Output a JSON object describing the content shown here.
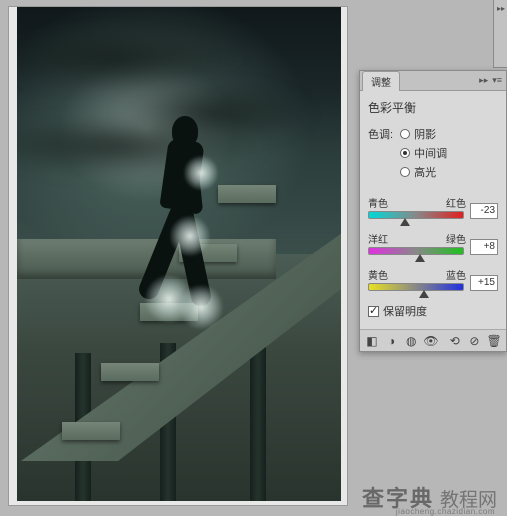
{
  "panel": {
    "tab_label": "调整",
    "title": "色彩平衡",
    "tone_label": "色调:",
    "tones": {
      "shadows": "阴影",
      "midtones": "中间调",
      "highlights": "高光"
    },
    "selected_tone": "midtones",
    "sliders": {
      "cyan_red": {
        "left": "青色",
        "right": "红色",
        "value": "-23",
        "pos_pct": 38
      },
      "magenta_green": {
        "left": "洋红",
        "right": "绿色",
        "value": "+8",
        "pos_pct": 54
      },
      "yellow_blue": {
        "left": "黄色",
        "right": "蓝色",
        "value": "+15",
        "pos_pct": 58
      }
    },
    "preserve_luminosity": "保留明度"
  },
  "watermark": {
    "main": "查字典",
    "sub": "教程网",
    "url": "jiaocheng.chazidian.com"
  }
}
